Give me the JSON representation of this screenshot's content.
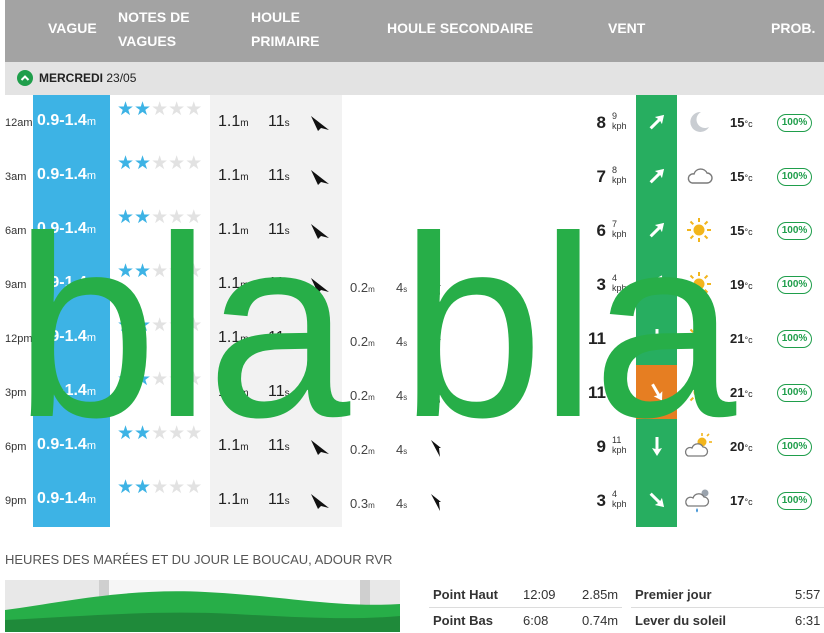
{
  "header": {
    "col_vague": "VAGUE",
    "col_notes": "NOTES DE\nVAGUES",
    "col_houle_primaire": "HOULE\nPRIMAIRE",
    "col_houle_secondaire": "HOULE SECONDAIRE",
    "col_vent": "VENT",
    "col_prob": "PROB."
  },
  "day": {
    "name": "MERCREDI",
    "date": "23/05"
  },
  "rows": [
    {
      "time": "12am",
      "wave": "0.9-1.4",
      "wave_unit": "m",
      "stars": 2,
      "prim_h": "1.1",
      "prim_p": "11",
      "prim_dir": 135,
      "sec_h": "",
      "sec_p": "",
      "wind": "8",
      "gust": "9",
      "wind_unit": "kph",
      "wind_dir": 45,
      "weather": "moon",
      "temp": "15",
      "prob": "100%"
    },
    {
      "time": "3am",
      "wave": "0.9-1.4",
      "wave_unit": "m",
      "stars": 2,
      "prim_h": "1.1",
      "prim_p": "11",
      "prim_dir": 135,
      "sec_h": "",
      "sec_p": "",
      "wind": "7",
      "gust": "8",
      "wind_unit": "kph",
      "wind_dir": 45,
      "weather": "cloud",
      "temp": "15",
      "prob": "100%"
    },
    {
      "time": "6am",
      "wave": "0.9-1.4",
      "wave_unit": "m",
      "stars": 2,
      "prim_h": "1.1",
      "prim_p": "11",
      "prim_dir": 135,
      "sec_h": "",
      "sec_p": "",
      "wind": "6",
      "gust": "7",
      "wind_unit": "kph",
      "wind_dir": 45,
      "weather": "sun",
      "temp": "15",
      "prob": "100%"
    },
    {
      "time": "9am",
      "wave": "0.9-1.4",
      "wave_unit": "m",
      "stars": 2,
      "prim_h": "1.1",
      "prim_p": "11",
      "prim_dir": 135,
      "sec_h": "0.2",
      "sec_p": "4",
      "wind": "3",
      "gust": "4",
      "wind_unit": "kph",
      "wind_dir": 30,
      "weather": "sun",
      "temp": "19",
      "prob": "100%"
    },
    {
      "time": "12pm",
      "wave": "0.9-1.4",
      "wave_unit": "m",
      "stars": 2,
      "prim_h": "1.1",
      "prim_p": "11",
      "prim_dir": 135,
      "sec_h": "0.2",
      "sec_p": "4",
      "wind": "11",
      "gust": "",
      "wind_unit": "kph",
      "wind_dir": 180,
      "weather": "sun",
      "temp": "21",
      "prob": "100%"
    },
    {
      "time": "3pm",
      "wave": "0.9-1.4",
      "wave_unit": "m",
      "stars": 2,
      "prim_h": "1.1",
      "prim_p": "11",
      "prim_dir": 135,
      "sec_h": "0.2",
      "sec_p": "4",
      "wind": "11",
      "gust": "",
      "wind_unit": "kph",
      "wind_dir": 150,
      "weather": "sun",
      "temp": "21",
      "prob": "100%"
    },
    {
      "time": "6pm",
      "wave": "0.9-1.4",
      "wave_unit": "m",
      "stars": 2,
      "prim_h": "1.1",
      "prim_p": "11",
      "prim_dir": 135,
      "sec_h": "0.2",
      "sec_p": "4",
      "wind": "9",
      "gust": "11",
      "wind_unit": "kph",
      "wind_dir": 180,
      "weather": "sun-cloud",
      "temp": "20",
      "prob": "100%"
    },
    {
      "time": "9pm",
      "wave": "0.9-1.4",
      "wave_unit": "m",
      "stars": 2,
      "prim_h": "1.1",
      "prim_p": "11",
      "prim_dir": 135,
      "sec_h": "0.3",
      "sec_p": "4",
      "wind": "3",
      "gust": "4",
      "wind_unit": "kph",
      "wind_dir": 135,
      "weather": "rain",
      "temp": "17",
      "prob": "100%"
    }
  ],
  "units": {
    "period": "s",
    "temp": "°c"
  },
  "overlay_text": {
    "word1": "bla",
    "word2": "bla"
  },
  "tides": {
    "title": "HEURES DES MARÉES ET DU JOUR LE BOUCAU, ADOUR RVR",
    "left": [
      {
        "label": "Point Haut",
        "time": "12:09",
        "height": "2.85m"
      },
      {
        "label": "Point Bas",
        "time": "6:08",
        "height": "0.74m"
      }
    ],
    "right": [
      {
        "label": "Premier jour",
        "time": "5:57"
      },
      {
        "label": "Lever du soleil",
        "time": "6:31"
      }
    ]
  },
  "colors": {
    "wave": "#3db3e5",
    "wind": "#27ae60",
    "wind_alert": "#e67e22",
    "prob": "#1f9e4b",
    "overlay": "#27ae48"
  }
}
